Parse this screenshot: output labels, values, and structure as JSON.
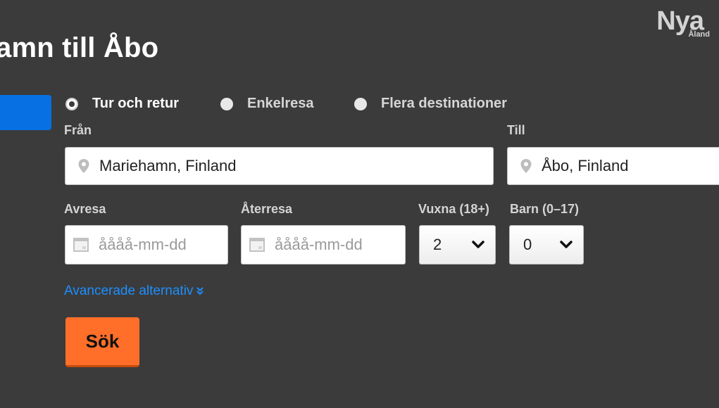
{
  "page": {
    "title": "amn till Åbo"
  },
  "logo": {
    "main": "Nya",
    "sub": "Åland"
  },
  "colors": {
    "background": "#3b3b3b",
    "tab_accent": "#0770e3",
    "link": "#1d8fff",
    "search_button": "#ff6f29"
  },
  "trip_type": {
    "options": [
      {
        "label": "Tur och retur",
        "checked": true
      },
      {
        "label": "Enkelresa",
        "checked": false
      },
      {
        "label": "Flera destinationer",
        "checked": false
      }
    ]
  },
  "from": {
    "label": "Från",
    "value": "Mariehamn, Finland",
    "icon": "location-pin-icon"
  },
  "to": {
    "label": "Till",
    "value": "Åbo, Finland",
    "icon": "location-pin-icon"
  },
  "depart": {
    "label": "Avresa",
    "placeholder": "åååå-mm-dd",
    "icon": "calendar-icon"
  },
  "return": {
    "label": "Återresa",
    "placeholder": "åååå-mm-dd",
    "icon": "calendar-icon"
  },
  "adults": {
    "label": "Vuxna (18+)",
    "value": "2",
    "icon": "chevron-down-icon"
  },
  "children": {
    "label": "Barn (0–17)",
    "value": "0",
    "icon": "chevron-down-icon"
  },
  "advanced": {
    "label": "Avancerade alternativ",
    "icon": "double-chevron-down-icon"
  },
  "search": {
    "label": "Sök"
  }
}
